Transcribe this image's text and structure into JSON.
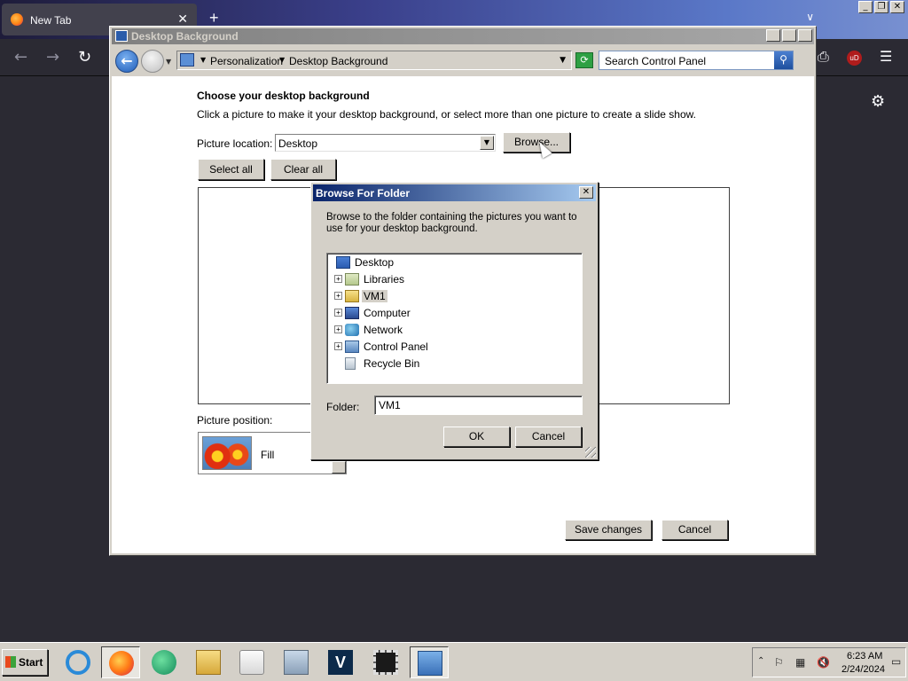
{
  "browser": {
    "tab_title": "New Tab",
    "new_tab_symbol": "+",
    "close_tab_symbol": "✕",
    "back_symbol": "←",
    "forward_symbol": "→",
    "reload_symbol": "↻",
    "extensions_symbol": "⎙",
    "ublock_label": "uD",
    "menu_symbol": "☰",
    "settings_symbol": "⚙",
    "list_all_symbol": "∨"
  },
  "os_controls": {
    "minimize": "_",
    "restore": "❐",
    "close": "✕"
  },
  "window": {
    "title": "Desktop Background",
    "breadcrumbs": [
      "Personalization",
      "Desktop Background"
    ],
    "search_placeholder": "Search Control Panel",
    "heading": "Choose your desktop background",
    "subtext": "Click a picture to make it your desktop background, or select more than one picture to create a slide show.",
    "picture_location_label": "Picture location:",
    "picture_location_value": "Desktop",
    "browse_label": "Browse...",
    "select_all_label": "Select all",
    "clear_all_label": "Clear all",
    "picture_position_label": "Picture position:",
    "picture_position_value": "Fill",
    "save_label": "Save changes",
    "cancel_label": "Cancel"
  },
  "dialog": {
    "title": "Browse For Folder",
    "description": "Browse to the folder containing the pictures you want to use for your desktop background.",
    "tree": [
      {
        "label": "Desktop",
        "icon": "desktop-icon",
        "expandable": false
      },
      {
        "label": "Libraries",
        "icon": "libraries-icon",
        "expandable": true
      },
      {
        "label": "VM1",
        "icon": "user-folder-icon",
        "expandable": true,
        "selected": true
      },
      {
        "label": "Computer",
        "icon": "computer-icon",
        "expandable": true
      },
      {
        "label": "Network",
        "icon": "network-icon",
        "expandable": true
      },
      {
        "label": "Control Panel",
        "icon": "control-panel-icon",
        "expandable": true
      },
      {
        "label": "Recycle Bin",
        "icon": "recycle-bin-icon",
        "expandable": false
      }
    ],
    "folder_label": "Folder:",
    "folder_value": "VM1",
    "ok_label": "OK",
    "cancel_label": "Cancel"
  },
  "taskbar": {
    "start_label": "Start",
    "apps": [
      "internet-explorer-icon",
      "firefox-icon",
      "chat-app-icon",
      "file-explorer-icon",
      "media-player-icon",
      "control-panel-tools-icon",
      "v18-app-icon",
      "video-editor-icon",
      "display-settings-icon"
    ],
    "v18_label": "V",
    "clock_time": "6:23 AM",
    "clock_date": "2/24/2024"
  }
}
